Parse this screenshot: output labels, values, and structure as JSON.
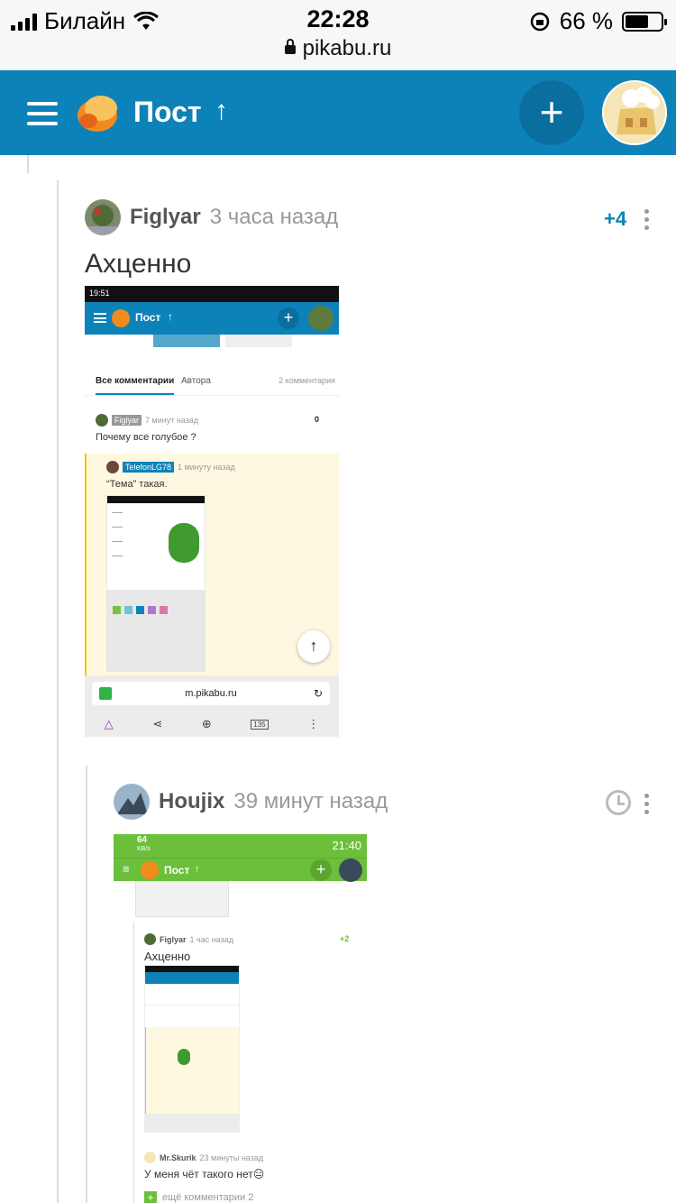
{
  "status_bar": {
    "carrier": "Билайн",
    "time": "22:28",
    "battery": "66 %",
    "battery_level": 0.66,
    "url": "pikabu.ru"
  },
  "app_bar": {
    "title": "Пост",
    "up_icon": "arrow-up-icon",
    "add_label": "+"
  },
  "comments": [
    {
      "author": "Figlyar",
      "time": "3 часа назад",
      "rating": "+4",
      "text": "Ахценно",
      "screenshot": {
        "status_time": "19:51",
        "header_title": "Пост",
        "tabs": [
          "Все комментарии",
          "Автора"
        ],
        "count": "2 комментария",
        "inner_comment_author": "Figlyar",
        "inner_comment_time": "7 минут назад",
        "inner_comment_rating": "0",
        "inner_comment_text": "Почему все голубое ?",
        "reply_author": "TelefonLG78",
        "reply_time": "1 минуту назад",
        "reply_text": "“Тема” такая.",
        "url": "m.pikabu.ru",
        "tabs_count": "135"
      }
    },
    {
      "author": "Houjix",
      "time": "39 минут назад",
      "screenshot": {
        "speed": "64",
        "speed_unit": "KB/s",
        "status_time": "21:40",
        "header_title": "Пост",
        "nested_author": "Figlyar",
        "nested_time": "1 час назад",
        "nested_rating": "+2",
        "nested_text": "Ахценно",
        "reply_author": "Mr.Skurik",
        "reply_time": "23 минуты назад",
        "reply_text": "У меня чёт такого нет😑",
        "more_comments": "ещё комментарии 2"
      }
    }
  ]
}
